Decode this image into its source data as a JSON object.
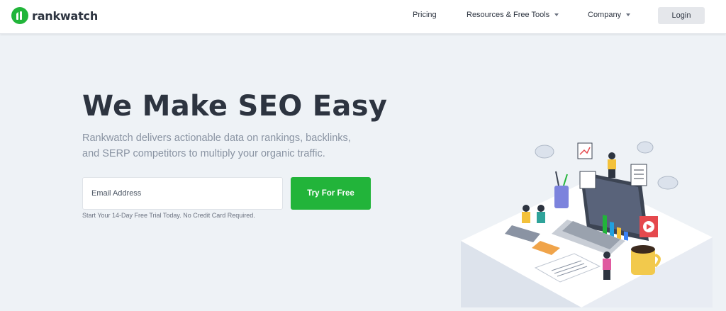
{
  "header": {
    "brand": "rankwatch",
    "nav": [
      {
        "label": "Pricing",
        "has_dropdown": false
      },
      {
        "label": "Resources & Free Tools",
        "has_dropdown": true
      },
      {
        "label": "Company",
        "has_dropdown": true
      }
    ],
    "login_label": "Login"
  },
  "hero": {
    "title": "We Make SEO Easy",
    "subtitle": "Rankwatch delivers actionable data on rankings, backlinks, and SERP competitors to multiply your organic traffic.",
    "email_placeholder": "Email Address",
    "cta_label": "Try For Free",
    "note": "Start Your 14-Day Free Trial Today. No Credit Card Required."
  },
  "colors": {
    "brand_green": "#22b43a",
    "text_dark": "#2d3440",
    "page_bg": "#eef2f6"
  }
}
